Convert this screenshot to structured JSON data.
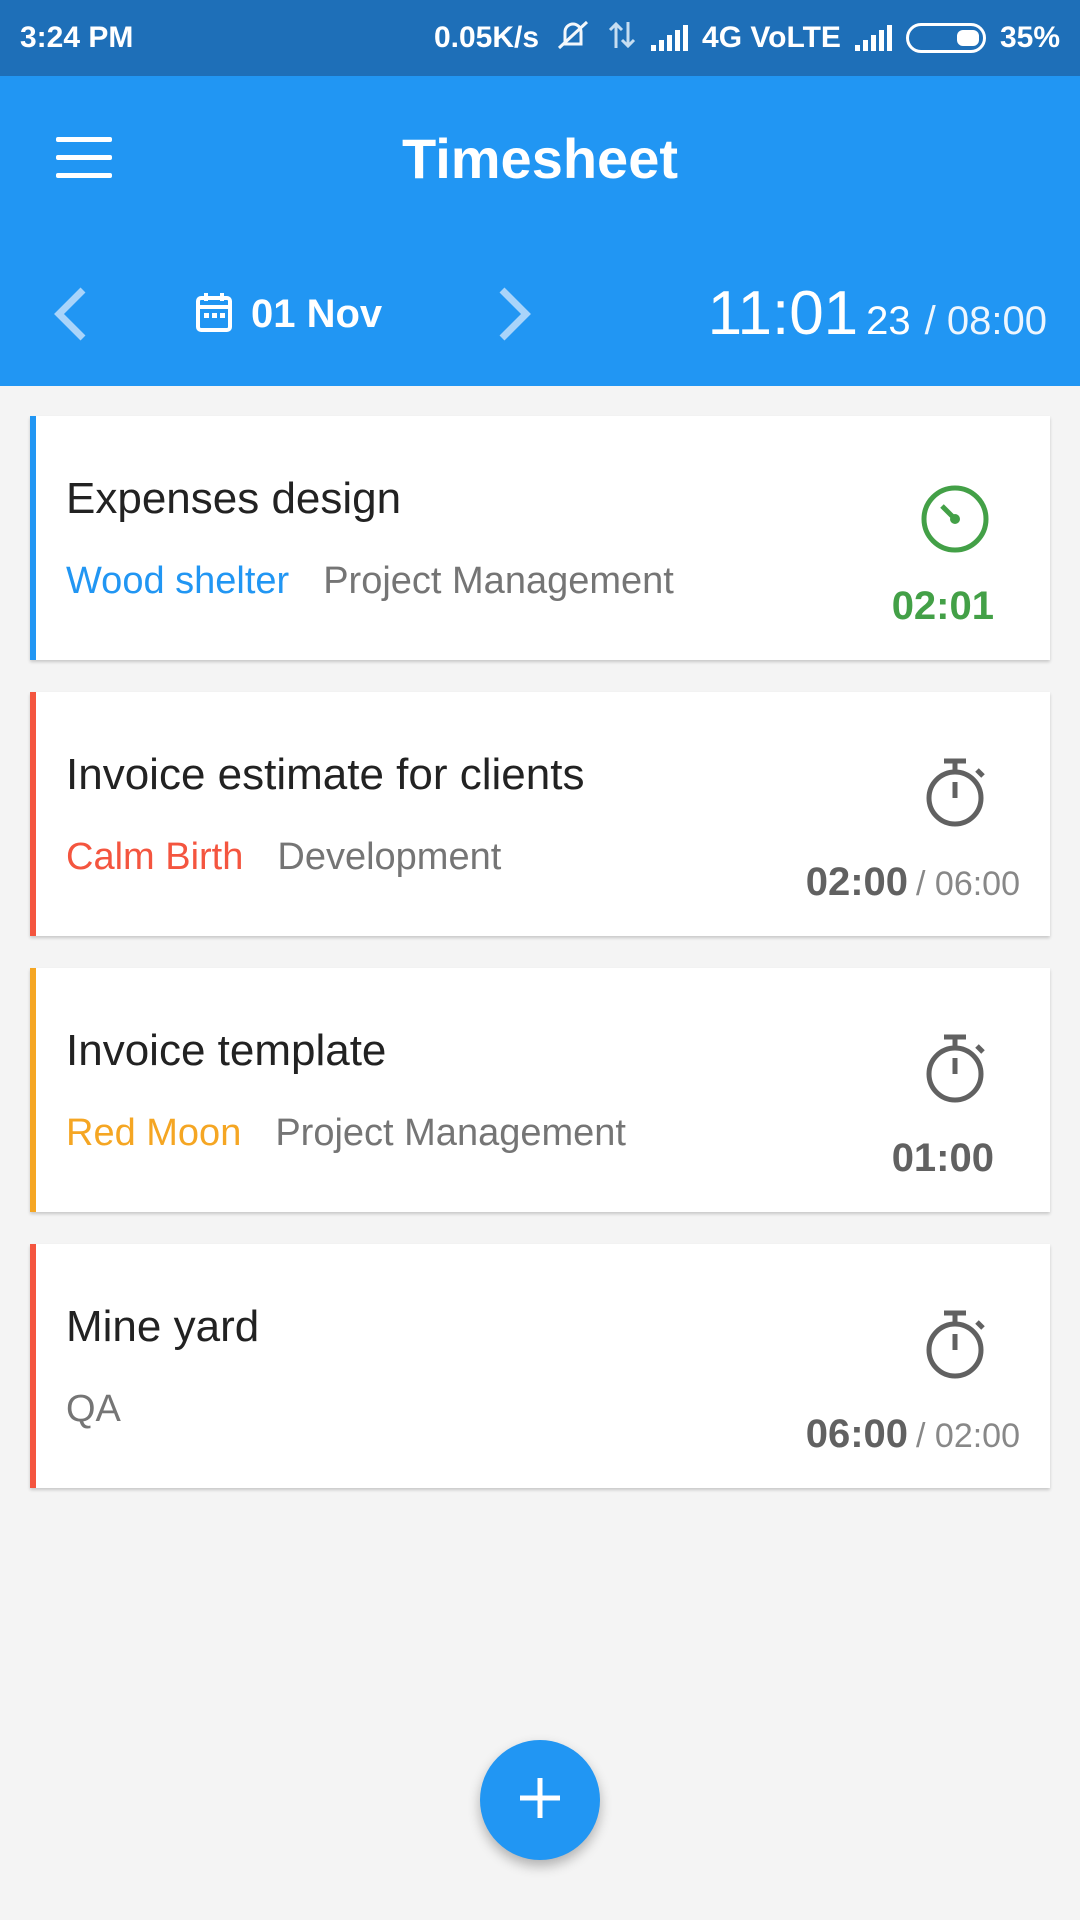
{
  "status_bar": {
    "time": "3:24 PM",
    "net_speed": "0.05K/s",
    "network": "4G VoLTE",
    "battery": "35%"
  },
  "header": {
    "title": "Timesheet",
    "date": "01 Nov",
    "time_main": "11:01",
    "time_seconds": "23",
    "time_target": "/ 08:00"
  },
  "icons": {
    "menu": "menu-icon",
    "prev": "chevron-left-icon",
    "next": "chevron-right-icon",
    "calendar": "calendar-icon",
    "running": "running-timer-icon",
    "stopwatch": "stopwatch-icon",
    "add": "plus-icon"
  },
  "colors": {
    "primary": "#2196f3",
    "primary_dark": "#1e6fb8",
    "running_green": "#43a047",
    "client_blue": "#2196f3",
    "client_red": "#f4553f",
    "client_yellow": "#f5a623"
  },
  "tasks": [
    {
      "title": "Expenses design",
      "client": "Wood shelter",
      "project": "Project Management",
      "duration": "02:01",
      "target": "",
      "accent": "#2196f3",
      "running": true
    },
    {
      "title": "Invoice estimate for clients",
      "client": "Calm Birth",
      "project": "Development",
      "duration": "02:00",
      "target": "/ 06:00",
      "accent": "#f4553f",
      "running": false
    },
    {
      "title": "Invoice template",
      "client": "Red Moon",
      "project": "Project Management",
      "duration": "01:00",
      "target": "",
      "accent": "#f5a623",
      "running": false
    },
    {
      "title": "Mine yard",
      "client": "",
      "project": "QA",
      "duration": "06:00",
      "target": "/ 02:00",
      "accent": "#f4553f",
      "running": false
    }
  ]
}
